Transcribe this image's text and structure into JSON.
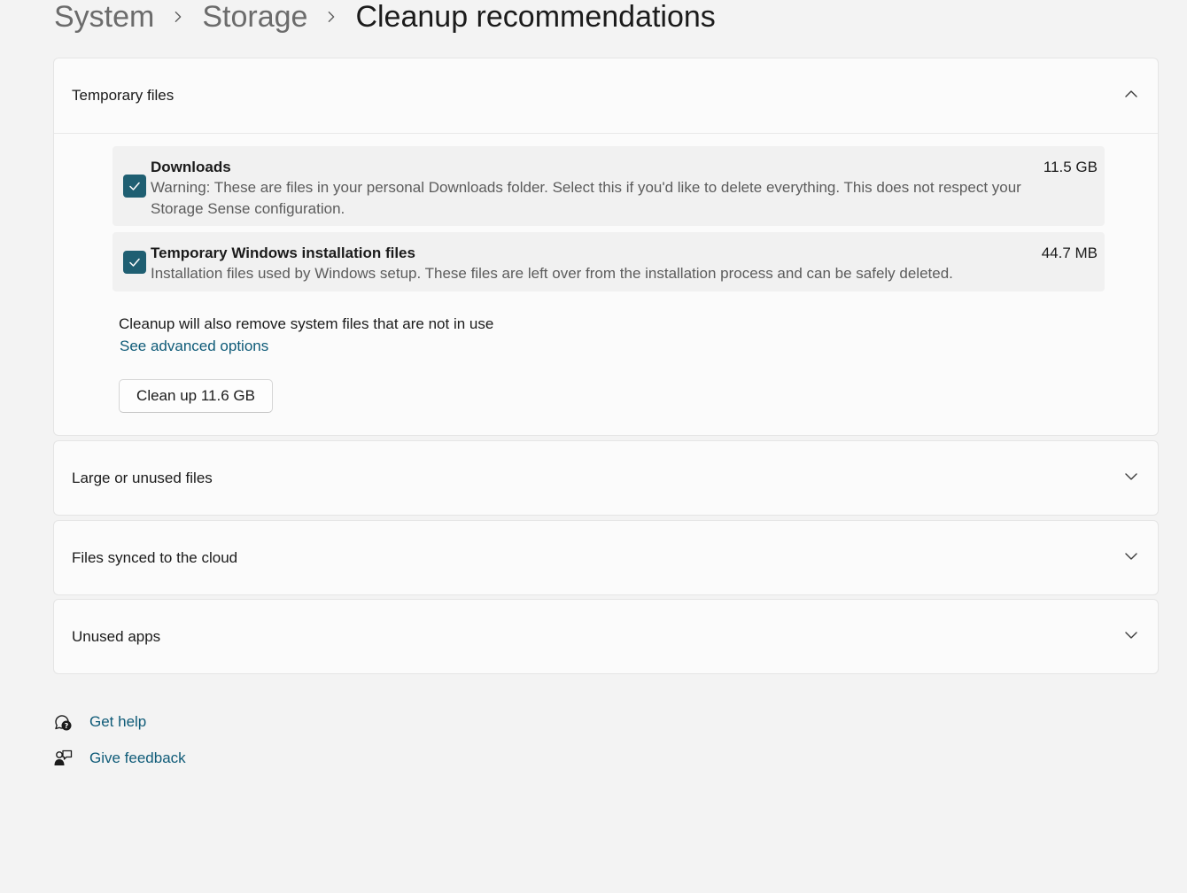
{
  "breadcrumb": {
    "items": [
      "System",
      "Storage"
    ],
    "current": "Cleanup recommendations"
  },
  "sections": {
    "temporary_files": {
      "title": "Temporary files",
      "expanded": true,
      "items": [
        {
          "title": "Downloads",
          "checked": true,
          "size": "11.5 GB",
          "description_line1": "Warning: These are files in your personal Downloads folder. Select this if you'd like to delete everything. This does not respect your",
          "description_line2": "Storage Sense configuration."
        },
        {
          "title": "Temporary Windows installation files",
          "checked": true,
          "size": "44.7 MB",
          "description_line1": "Installation files used by Windows setup.  These files are left over from the installation process and can be safely deleted."
        }
      ],
      "note": "Cleanup will also remove system files that are not in use",
      "advanced_link": "See advanced options",
      "cleanup_button": "Clean up 11.6 GB"
    },
    "large_unused": {
      "title": "Large or unused files",
      "expanded": false
    },
    "cloud_synced": {
      "title": "Files synced to the cloud",
      "expanded": false
    },
    "unused_apps": {
      "title": "Unused apps",
      "expanded": false
    }
  },
  "footer": {
    "get_help": "Get help",
    "give_feedback": "Give feedback"
  },
  "colors": {
    "accent": "#1f5f72",
    "link": "#0f5b78",
    "background": "#f3f3f3",
    "card": "#fbfbfb"
  },
  "icons": {
    "breadcrumb_separator": "chevron-right-icon",
    "expanded": "chevron-up-icon",
    "collapsed": "chevron-down-icon",
    "checkbox": "checkmark-icon",
    "help": "help-chat-icon",
    "feedback": "feedback-person-icon"
  }
}
